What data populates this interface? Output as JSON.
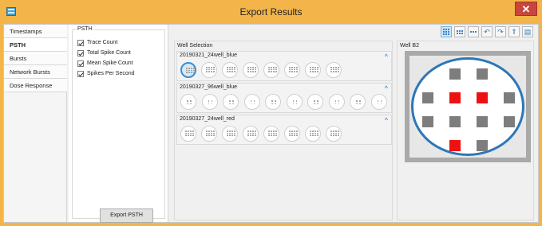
{
  "window": {
    "title": "Export Results",
    "close_glyph": "✕",
    "accent": "#f3b54a"
  },
  "sidebar": {
    "items": [
      {
        "label": "Timestamps",
        "active": false
      },
      {
        "label": "PSTH",
        "active": true
      },
      {
        "label": "Bursts",
        "active": false
      },
      {
        "label": "Network Bursts",
        "active": false
      },
      {
        "label": "Dose Response",
        "active": false
      }
    ]
  },
  "psth": {
    "group_title": "PSTH",
    "options": [
      {
        "label": "Trace Count",
        "checked": true
      },
      {
        "label": "Total Spike Count",
        "checked": true
      },
      {
        "label": "Mean Spike Count",
        "checked": true
      },
      {
        "label": "Spikes Per Second",
        "checked": true
      }
    ],
    "export_label": "Export PSTH"
  },
  "toolbar": {
    "icons": [
      "grid-large-icon",
      "grid-medium-icon",
      "grid-small-icon",
      "undo-icon",
      "redo-icon",
      "export-plate-icon",
      "export-well-icon"
    ]
  },
  "well_selection": {
    "label": "Well Selection",
    "plates": [
      {
        "name": "20190321_24well_blue",
        "wells": 8,
        "style": "dense",
        "selected_index": 0,
        "collapse_glyph": "^"
      },
      {
        "name": "20190327_96well_blue",
        "wells": 10,
        "style": "sparse",
        "selected_index": -1,
        "collapse_glyph": "^"
      },
      {
        "name": "20190327_24well_red",
        "wells": 8,
        "style": "dense",
        "selected_index": -1,
        "collapse_glyph": "^"
      }
    ]
  },
  "well_detail": {
    "label": "Well B2",
    "electrode_grid": [
      [
        0,
        1,
        1,
        0
      ],
      [
        1,
        2,
        2,
        1
      ],
      [
        1,
        1,
        1,
        1
      ],
      [
        0,
        2,
        1,
        0
      ]
    ],
    "colors": {
      "active": "#ee1111",
      "inactive": "#7d7d7d",
      "ring": "#2c77b8"
    }
  }
}
